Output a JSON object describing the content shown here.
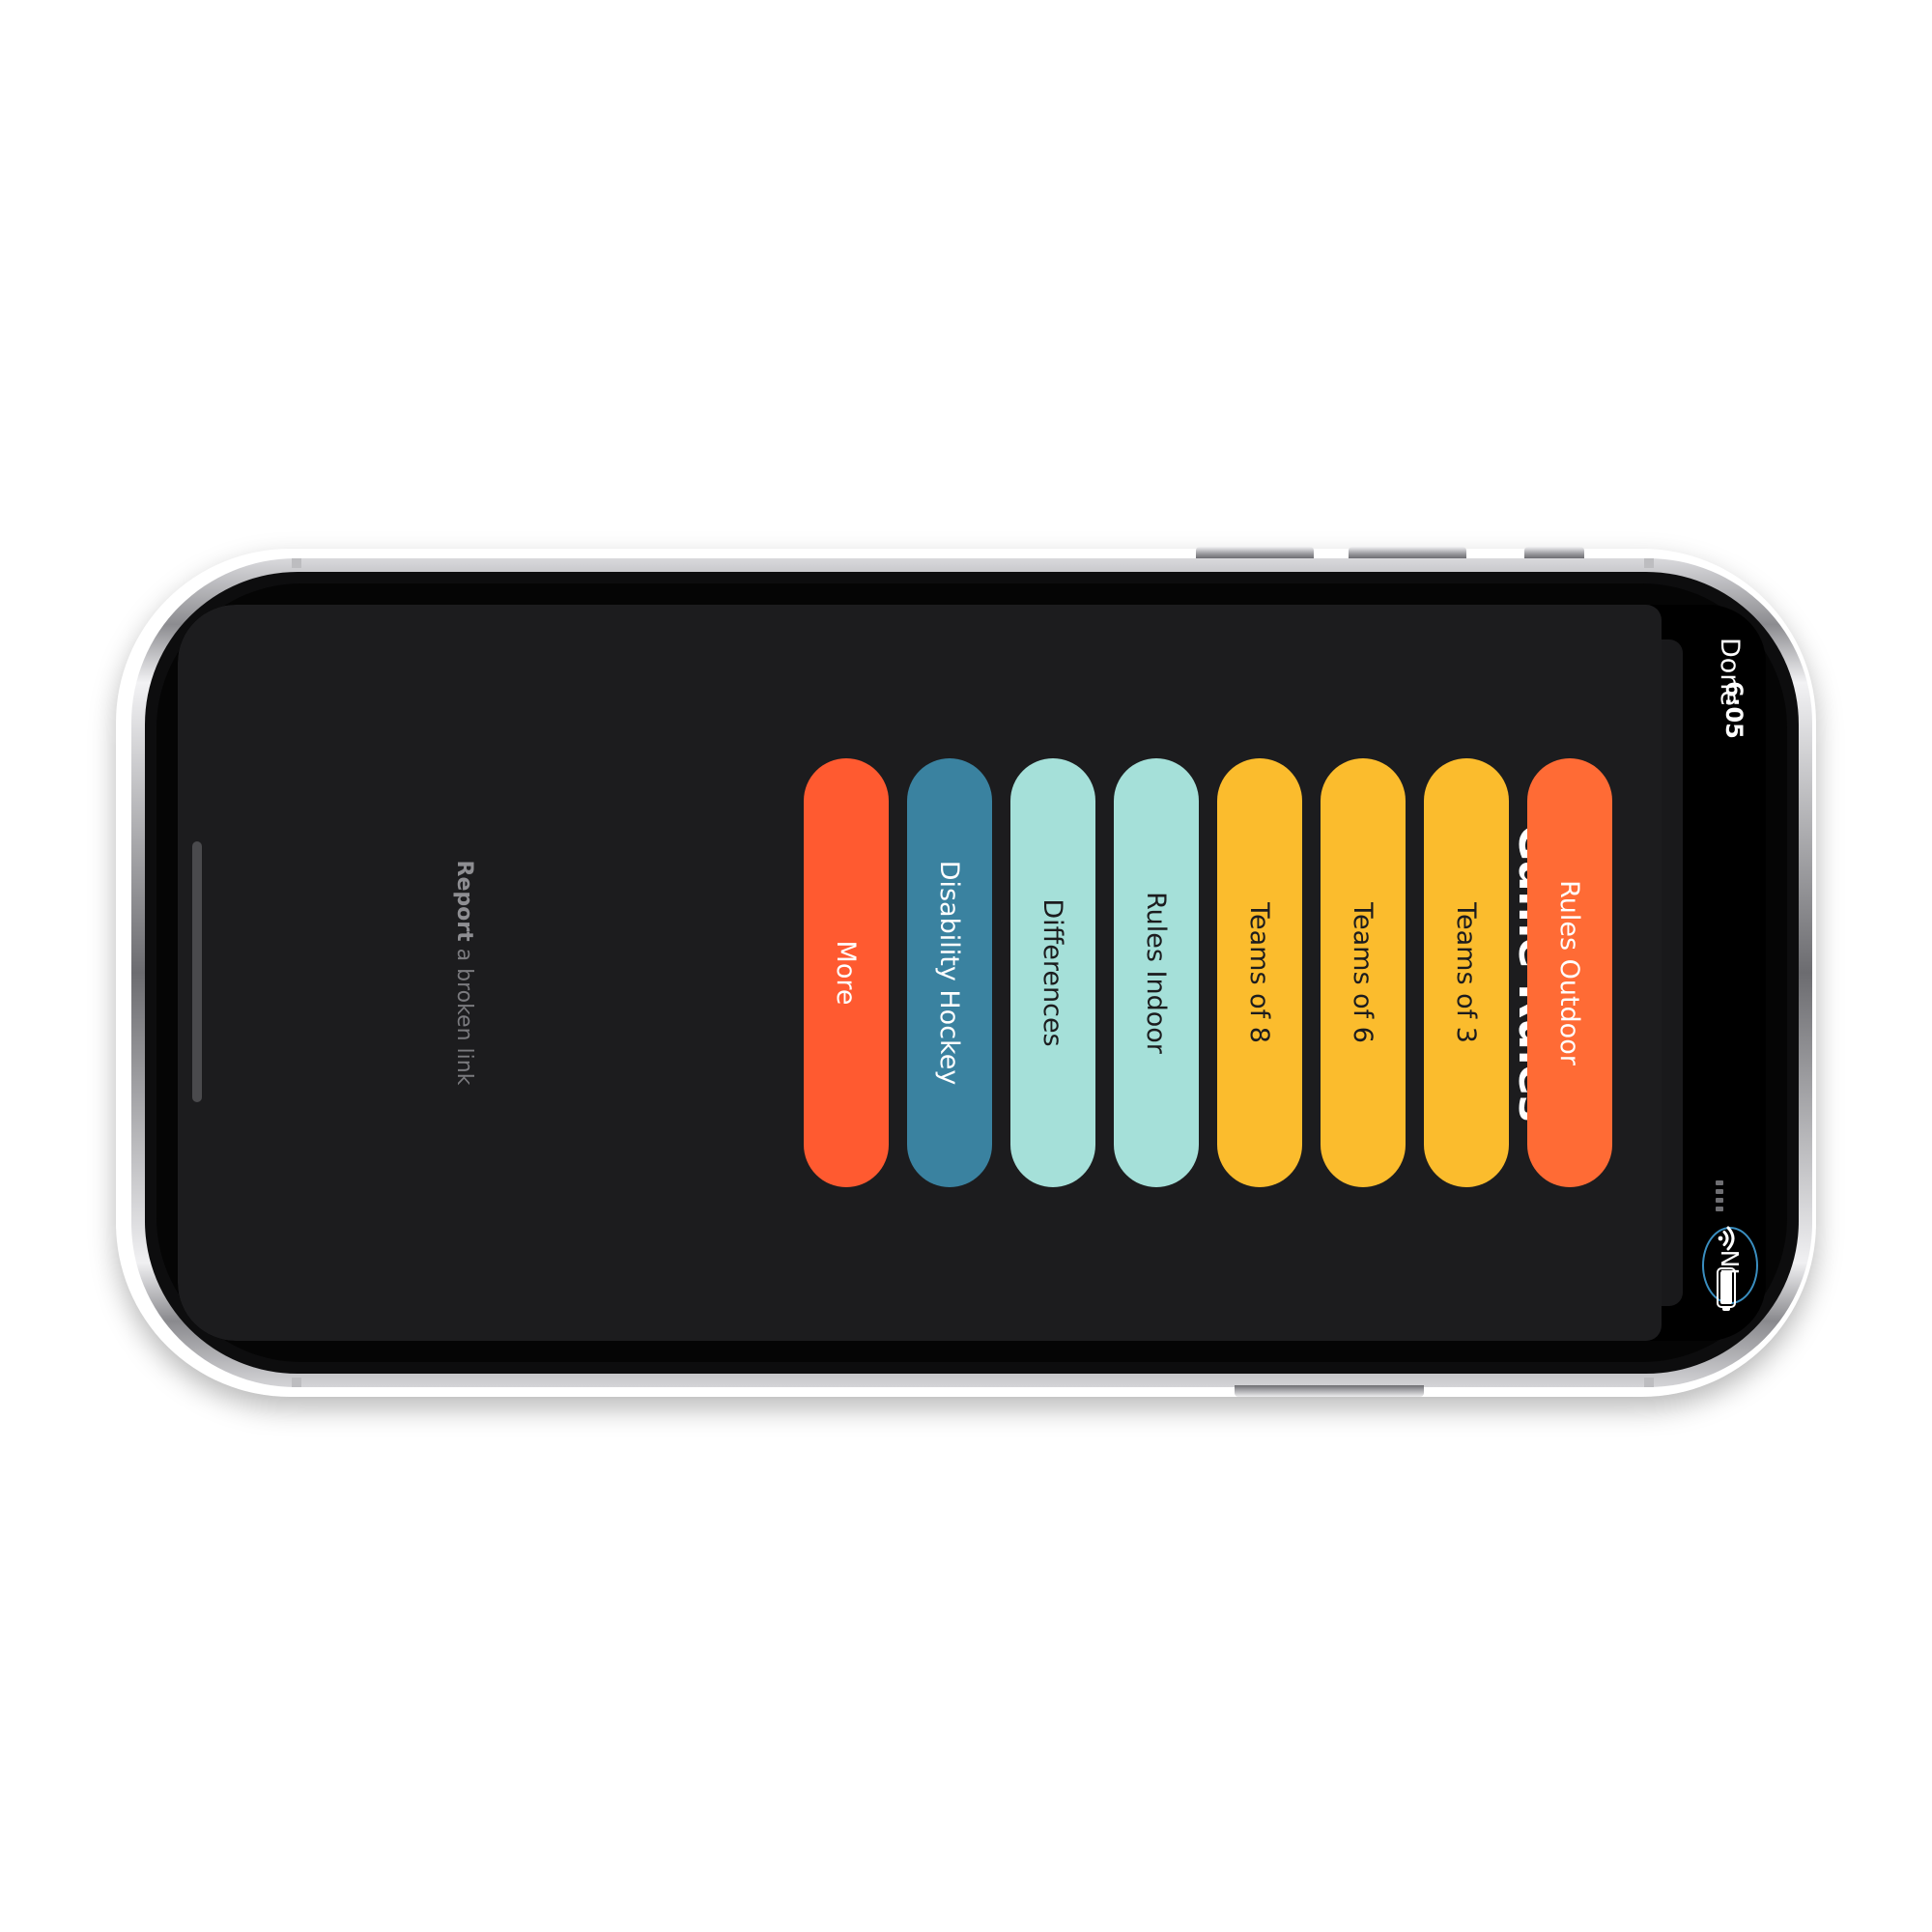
{
  "status_bar": {
    "time": "6:05"
  },
  "header": {
    "done_label": "Done",
    "title": "Game Rules",
    "language_badge": "NL"
  },
  "menu": {
    "items": [
      {
        "label": "Rules Outdoor",
        "bg": "#ff6b35",
        "fg": "#ffffff"
      },
      {
        "label": "Teams of 3",
        "bg": "#fbbc2d",
        "fg": "#1c1c1e"
      },
      {
        "label": "Teams of 6",
        "bg": "#fbbc2d",
        "fg": "#1c1c1e"
      },
      {
        "label": "Teams of 8",
        "bg": "#fbbc2d",
        "fg": "#1c1c1e"
      },
      {
        "label": "Rules Indoor",
        "bg": "#a5e0d9",
        "fg": "#1c1c1e"
      },
      {
        "label": "Differences",
        "bg": "#a5e0d9",
        "fg": "#1c1c1e"
      },
      {
        "label": "Disability Hockey",
        "bg": "#3a82a0",
        "fg": "#ffffff"
      },
      {
        "label": "More",
        "bg": "#ff5a30",
        "fg": "#ffffff"
      }
    ]
  },
  "footer": {
    "report_bold": "Report",
    "report_rest": " a broken link"
  },
  "colors": {
    "sheet_background": "#1c1c1e",
    "badge_border": "#3a8ec0"
  }
}
